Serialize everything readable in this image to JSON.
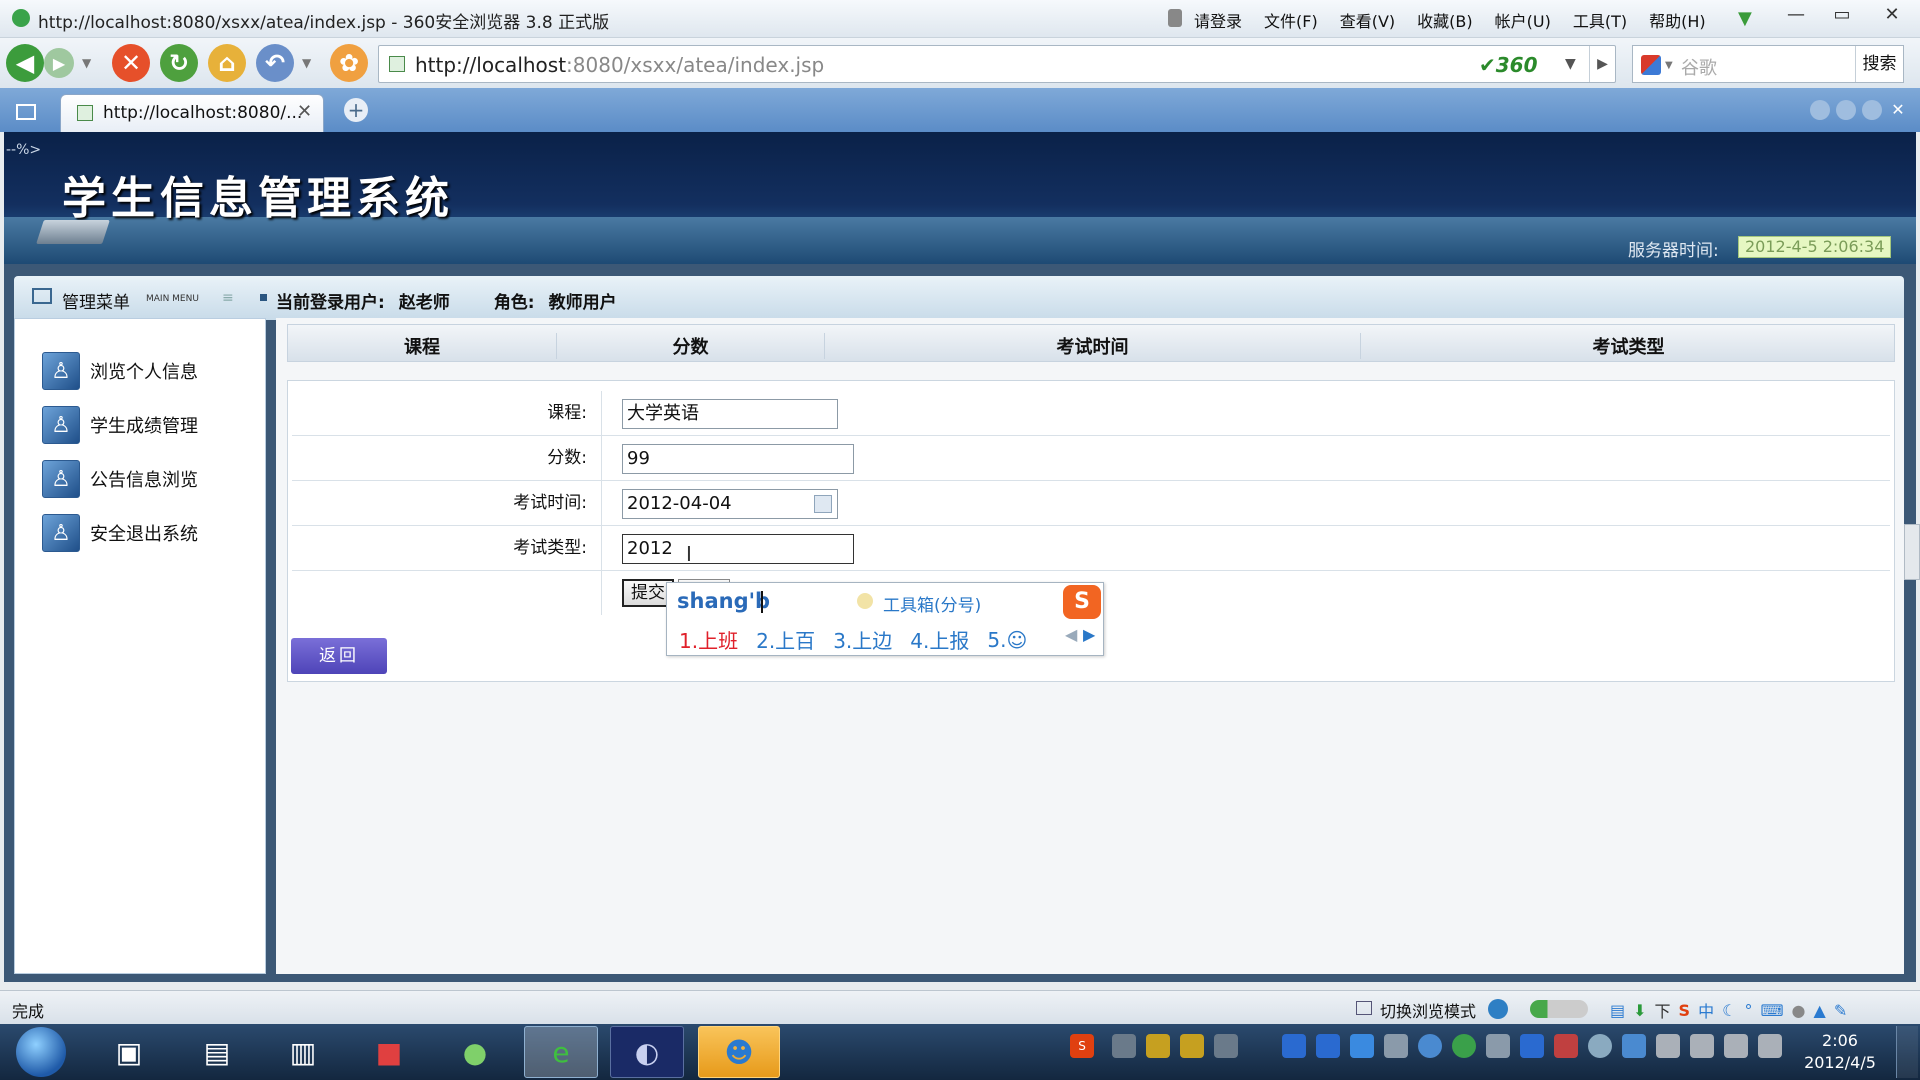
{
  "browser": {
    "window_title": "http://localhost:8080/xsxx/atea/index.jsp - 360安全浏览器 3.8 正式版",
    "menus": [
      "请登录",
      "文件(F)",
      "查看(V)",
      "收藏(B)",
      "帐户(U)",
      "工具(T)",
      "帮助(H)"
    ],
    "url_host": "http://localhost",
    "url_rest": ":8080/xsxx/atea/index.jsp",
    "brand_badge": "360",
    "search_placeholder": "谷歌",
    "search_button": "搜索",
    "tab_title": "http://localhost:8080/...",
    "status_text": "完成",
    "mode_switch": "切换浏览模式"
  },
  "page": {
    "corner_text": "--%>",
    "system_title": "学生信息管理系统",
    "server_time_label": "服务器时间:",
    "server_time": "2012-4-5 2:06:34",
    "menu_title": "管理菜单",
    "menu_subtitle": "MAIN MENU",
    "current_user_label": "当前登录用户:",
    "current_user": "赵老师",
    "role_label": "角色:",
    "role": "教师用户",
    "sidebar": [
      {
        "label": "浏览个人信息",
        "icon": "user-profile-icon"
      },
      {
        "label": "学生成绩管理",
        "icon": "grades-icon"
      },
      {
        "label": "公告信息浏览",
        "icon": "notice-icon"
      },
      {
        "label": "安全退出系统",
        "icon": "logout-icon"
      }
    ],
    "table_headers": [
      "课程",
      "分数",
      "考试时间",
      "考试类型"
    ],
    "form": {
      "course_label": "课程:",
      "course_value": "大学英语",
      "score_label": "分数:",
      "score_value": "99",
      "exam_time_label": "考试时间:",
      "exam_time_value": "2012-04-04",
      "exam_type_label": "考试类型:",
      "exam_type_value": "2012",
      "submit_label": "提交"
    },
    "back_button": "返回"
  },
  "ime": {
    "composition": "shang'b",
    "toolbox": "工具箱(分号)",
    "candidates": [
      "1.上班",
      "2.上百",
      "3.上边",
      "4.上报",
      "5.☺"
    ]
  },
  "taskbar": {
    "ime_indicator": "中",
    "clock_time": "2:06",
    "clock_date": "2012/4/5"
  },
  "colors": {
    "header_dark": "#0a2148",
    "back_button": "#5a50c4",
    "candidate_first": "#e0202a",
    "candidate": "#2a78c8"
  }
}
